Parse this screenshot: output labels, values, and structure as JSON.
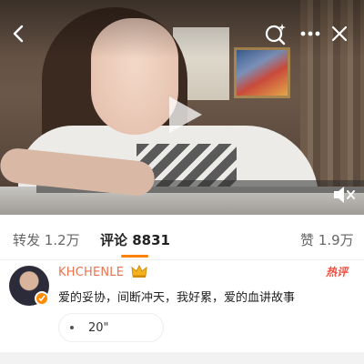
{
  "video": {
    "back_icon": "chevron-left-icon",
    "search_icon": "sparkle-search-icon",
    "more_icon": "more-dots-icon",
    "close_icon": "close-icon",
    "play_icon": "play-icon",
    "mute_icon": "speaker-muted-icon"
  },
  "stats": {
    "repost_label": "转发",
    "repost_count": "1.2万",
    "comment_label": "评论",
    "comment_count": "8831",
    "like_label": "赞",
    "like_count": "1.9万",
    "accent": "#ff8200"
  },
  "comment": {
    "username": "KHCHENLE",
    "badge_icon": "crown-icon",
    "hot_label": "热评",
    "text": "爱的妥协，间断冲天，我好累，爱的血讲故事",
    "voice_duration": "20\"",
    "username_color": "#eb7350"
  }
}
